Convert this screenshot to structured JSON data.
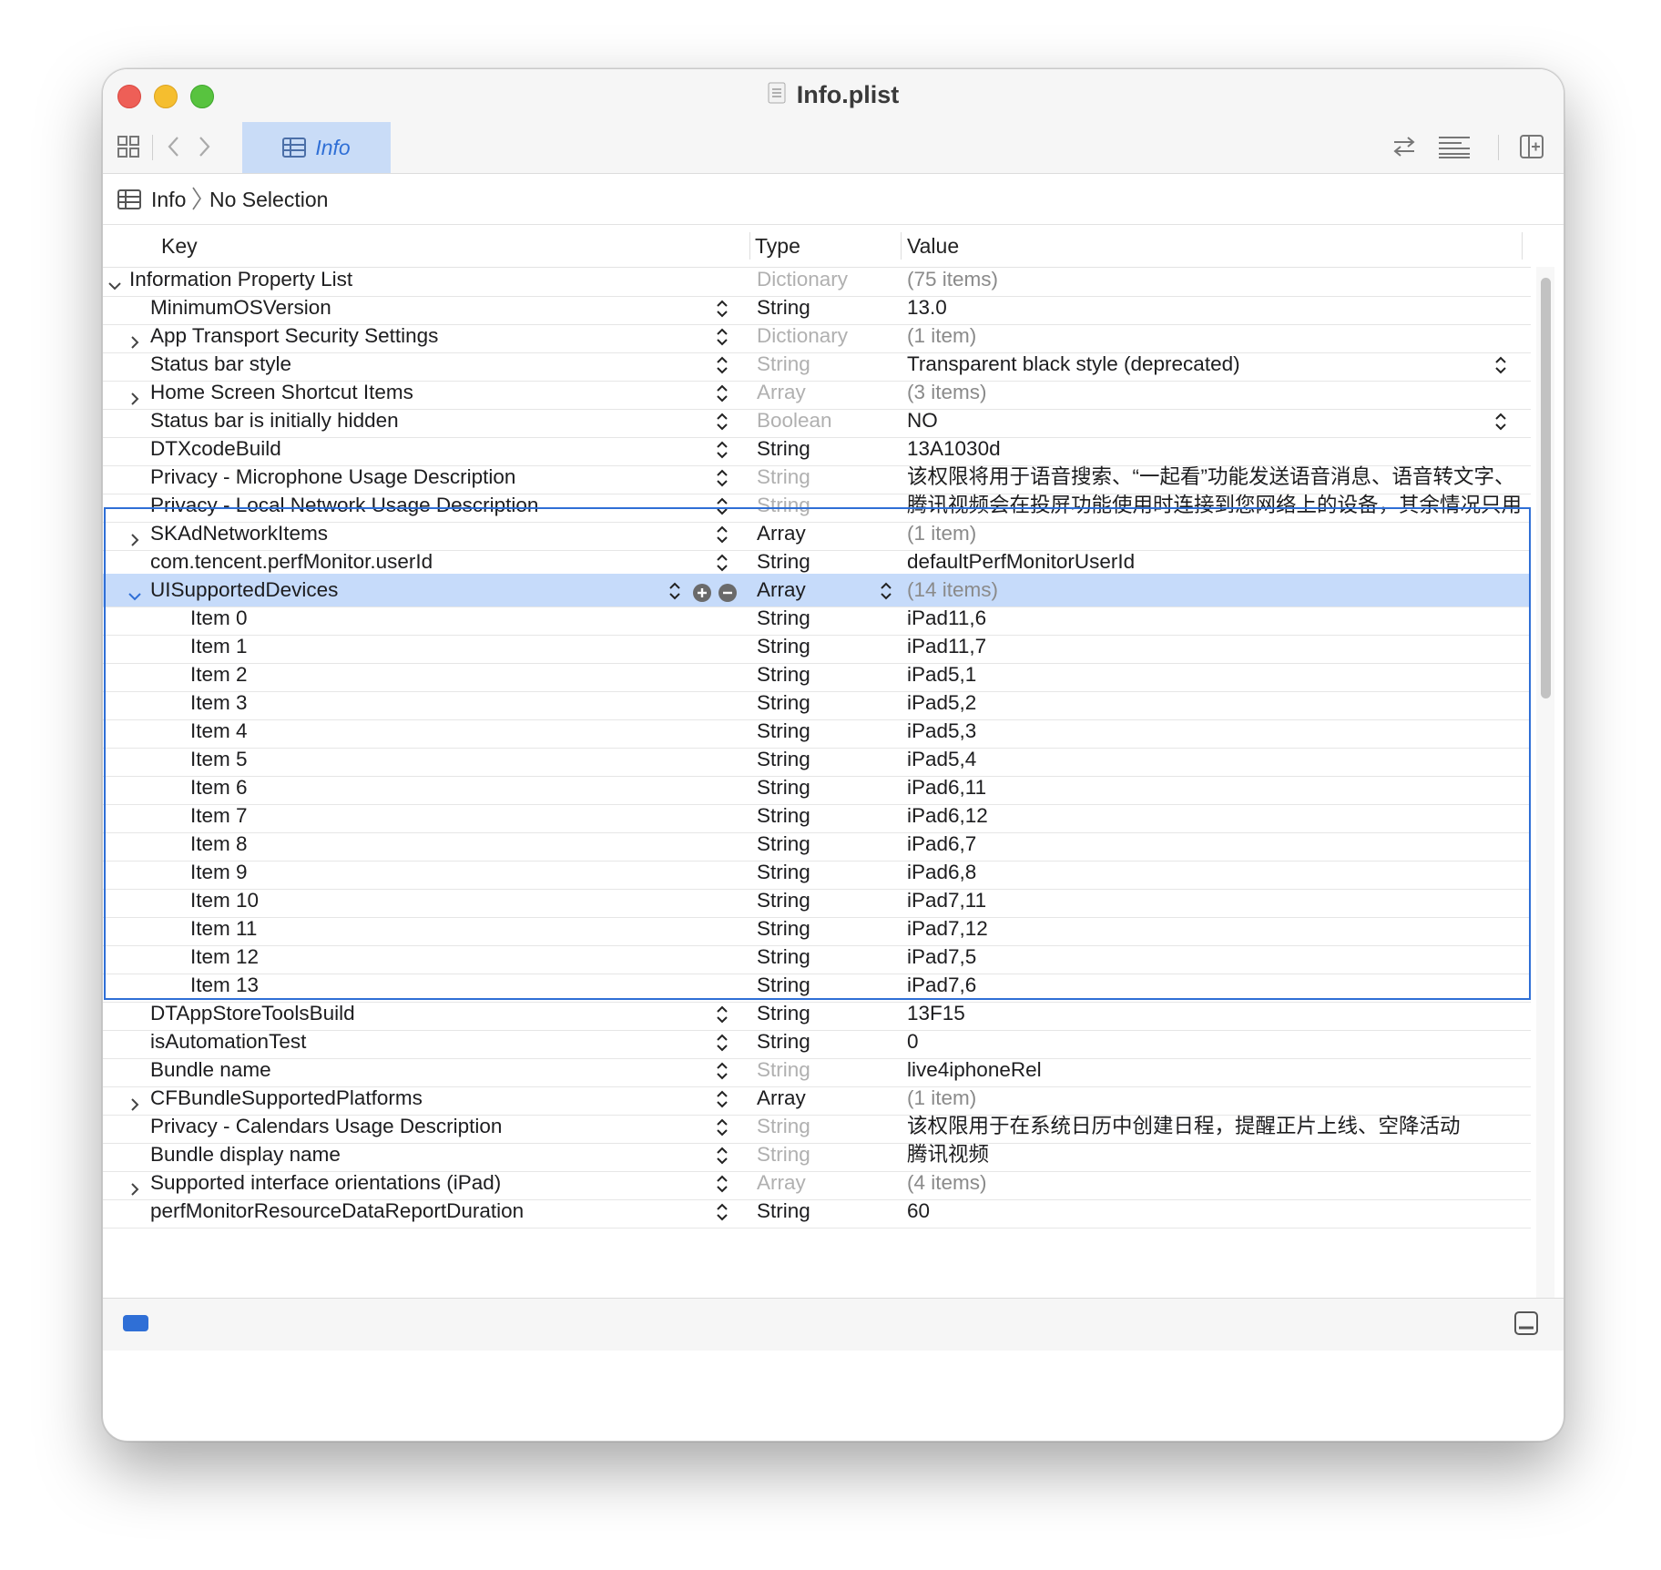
{
  "window": {
    "title": "Info.plist"
  },
  "toolbar": {
    "active_tab": "Info"
  },
  "jumpbar": {
    "file": "Info",
    "selection": "No Selection"
  },
  "columns": {
    "key": "Key",
    "type": "Type",
    "value": "Value"
  },
  "rows": [
    {
      "key": "Information Property List",
      "type": "Dictionary",
      "value": "(75 items)",
      "level": 0,
      "disclosure": "expanded",
      "type_muted": true,
      "value_muted": true,
      "stepper": false
    },
    {
      "key": "MinimumOSVersion",
      "type": "String",
      "value": "13.0",
      "level": 1,
      "disclosure": "none",
      "type_muted": false,
      "value_muted": false,
      "stepper": true
    },
    {
      "key": "App Transport Security Settings",
      "type": "Dictionary",
      "value": "(1 item)",
      "level": 1,
      "disclosure": "collapsed",
      "type_muted": true,
      "value_muted": true,
      "stepper": true
    },
    {
      "key": "Status bar style",
      "type": "String",
      "value": "Transparent black style (deprecated)",
      "level": 1,
      "disclosure": "none",
      "type_muted": true,
      "value_muted": false,
      "stepper": true,
      "value_popup": true
    },
    {
      "key": "Home Screen Shortcut Items",
      "type": "Array",
      "value": "(3 items)",
      "level": 1,
      "disclosure": "collapsed",
      "type_muted": true,
      "value_muted": true,
      "stepper": true
    },
    {
      "key": "Status bar is initially hidden",
      "type": "Boolean",
      "value": "NO",
      "level": 1,
      "disclosure": "none",
      "type_muted": true,
      "value_muted": false,
      "stepper": true,
      "value_popup": true
    },
    {
      "key": "DTXcodeBuild",
      "type": "String",
      "value": "13A1030d",
      "level": 1,
      "disclosure": "none",
      "type_muted": false,
      "value_muted": false,
      "stepper": true
    },
    {
      "key": "Privacy - Microphone Usage Description",
      "type": "String",
      "value": "该权限将用于语音搜索、“一起看”功能发送语音消息、语音转文字、",
      "level": 1,
      "disclosure": "none",
      "type_muted": true,
      "value_muted": false,
      "stepper": true
    },
    {
      "key": "Privacy - Local Network Usage Description",
      "type": "String",
      "value": "腾讯视频会在投屏功能使用时连接到您网络上的设备，其余情况只用",
      "level": 1,
      "disclosure": "none",
      "type_muted": true,
      "value_muted": false,
      "stepper": true
    },
    {
      "key": "SKAdNetworkItems",
      "type": "Array",
      "value": "(1 item)",
      "level": 1,
      "disclosure": "collapsed",
      "type_muted": false,
      "value_muted": true,
      "stepper": true
    },
    {
      "key": "com.tencent.perfMonitor.userId",
      "type": "String",
      "value": "defaultPerfMonitorUserId",
      "level": 1,
      "disclosure": "none",
      "type_muted": false,
      "value_muted": false,
      "stepper": true
    },
    {
      "key": "UISupportedDevices",
      "type": "Array",
      "value": "(14 items)",
      "level": 1,
      "disclosure": "expanded",
      "type_muted": false,
      "value_muted": true,
      "stepper": true,
      "selected": true
    },
    {
      "key": "Item 0",
      "type": "String",
      "value": "iPad11,6",
      "level": 2,
      "disclosure": "none",
      "type_muted": false,
      "value_muted": false,
      "stepper": false
    },
    {
      "key": "Item 1",
      "type": "String",
      "value": "iPad11,7",
      "level": 2,
      "disclosure": "none",
      "type_muted": false,
      "value_muted": false,
      "stepper": false
    },
    {
      "key": "Item 2",
      "type": "String",
      "value": "iPad5,1",
      "level": 2,
      "disclosure": "none",
      "type_muted": false,
      "value_muted": false,
      "stepper": false
    },
    {
      "key": "Item 3",
      "type": "String",
      "value": "iPad5,2",
      "level": 2,
      "disclosure": "none",
      "type_muted": false,
      "value_muted": false,
      "stepper": false
    },
    {
      "key": "Item 4",
      "type": "String",
      "value": "iPad5,3",
      "level": 2,
      "disclosure": "none",
      "type_muted": false,
      "value_muted": false,
      "stepper": false
    },
    {
      "key": "Item 5",
      "type": "String",
      "value": "iPad5,4",
      "level": 2,
      "disclosure": "none",
      "type_muted": false,
      "value_muted": false,
      "stepper": false
    },
    {
      "key": "Item 6",
      "type": "String",
      "value": "iPad6,11",
      "level": 2,
      "disclosure": "none",
      "type_muted": false,
      "value_muted": false,
      "stepper": false
    },
    {
      "key": "Item 7",
      "type": "String",
      "value": "iPad6,12",
      "level": 2,
      "disclosure": "none",
      "type_muted": false,
      "value_muted": false,
      "stepper": false
    },
    {
      "key": "Item 8",
      "type": "String",
      "value": "iPad6,7",
      "level": 2,
      "disclosure": "none",
      "type_muted": false,
      "value_muted": false,
      "stepper": false
    },
    {
      "key": "Item 9",
      "type": "String",
      "value": "iPad6,8",
      "level": 2,
      "disclosure": "none",
      "type_muted": false,
      "value_muted": false,
      "stepper": false
    },
    {
      "key": "Item 10",
      "type": "String",
      "value": "iPad7,11",
      "level": 2,
      "disclosure": "none",
      "type_muted": false,
      "value_muted": false,
      "stepper": false
    },
    {
      "key": "Item 11",
      "type": "String",
      "value": "iPad7,12",
      "level": 2,
      "disclosure": "none",
      "type_muted": false,
      "value_muted": false,
      "stepper": false
    },
    {
      "key": "Item 12",
      "type": "String",
      "value": "iPad7,5",
      "level": 2,
      "disclosure": "none",
      "type_muted": false,
      "value_muted": false,
      "stepper": false
    },
    {
      "key": "Item 13",
      "type": "String",
      "value": "iPad7,6",
      "level": 2,
      "disclosure": "none",
      "type_muted": false,
      "value_muted": false,
      "stepper": false
    },
    {
      "key": "DTAppStoreToolsBuild",
      "type": "String",
      "value": "13F15",
      "level": 1,
      "disclosure": "none",
      "type_muted": false,
      "value_muted": false,
      "stepper": true
    },
    {
      "key": "isAutomationTest",
      "type": "String",
      "value": "0",
      "level": 1,
      "disclosure": "none",
      "type_muted": false,
      "value_muted": false,
      "stepper": true
    },
    {
      "key": "Bundle name",
      "type": "String",
      "value": "live4iphoneRel",
      "level": 1,
      "disclosure": "none",
      "type_muted": true,
      "value_muted": false,
      "stepper": true
    },
    {
      "key": "CFBundleSupportedPlatforms",
      "type": "Array",
      "value": "(1 item)",
      "level": 1,
      "disclosure": "collapsed",
      "type_muted": false,
      "value_muted": true,
      "stepper": true
    },
    {
      "key": "Privacy - Calendars Usage Description",
      "type": "String",
      "value": "该权限用于在系统日历中创建日程，提醒正片上线、空降活动",
      "level": 1,
      "disclosure": "none",
      "type_muted": true,
      "value_muted": false,
      "stepper": true
    },
    {
      "key": "Bundle display name",
      "type": "String",
      "value": "腾讯视频",
      "level": 1,
      "disclosure": "none",
      "type_muted": true,
      "value_muted": false,
      "stepper": true
    },
    {
      "key": "Supported interface orientations (iPad)",
      "type": "Array",
      "value": "(4 items)",
      "level": 1,
      "disclosure": "collapsed",
      "type_muted": true,
      "value_muted": true,
      "stepper": true
    },
    {
      "key": "perfMonitorResourceDataReportDuration",
      "type": "String",
      "value": "60",
      "level": 1,
      "disclosure": "none",
      "type_muted": false,
      "value_muted": false,
      "stepper": true
    }
  ],
  "colors": {
    "accent": "#2f6fd6",
    "selection": "#c6dbfa",
    "close": "#ee5f57",
    "minimize": "#f5be2f",
    "zoom": "#58c33f"
  }
}
